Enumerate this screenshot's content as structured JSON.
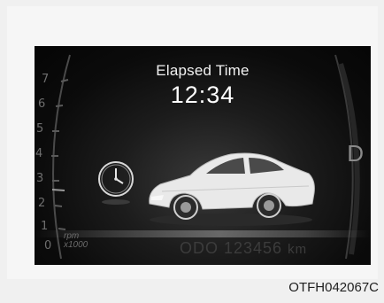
{
  "display": {
    "title": "Elapsed Time",
    "time": "12:34",
    "gear": "D",
    "odometer": "ODO 123456",
    "odometer_unit": "km",
    "rpm_label": "rpm",
    "rpm_multiplier": "x1000"
  },
  "tach_ticks": [
    "7",
    "6",
    "5",
    "4",
    "3",
    "2",
    "1",
    "0"
  ],
  "icons": {
    "clock": "analog-clock-icon",
    "car": "sedan-car-icon"
  },
  "caption": "OTFH042067C",
  "colors": {
    "screen": "#0b0b0b",
    "text": "#f2f2f2",
    "dim": "#6e6e6e"
  }
}
